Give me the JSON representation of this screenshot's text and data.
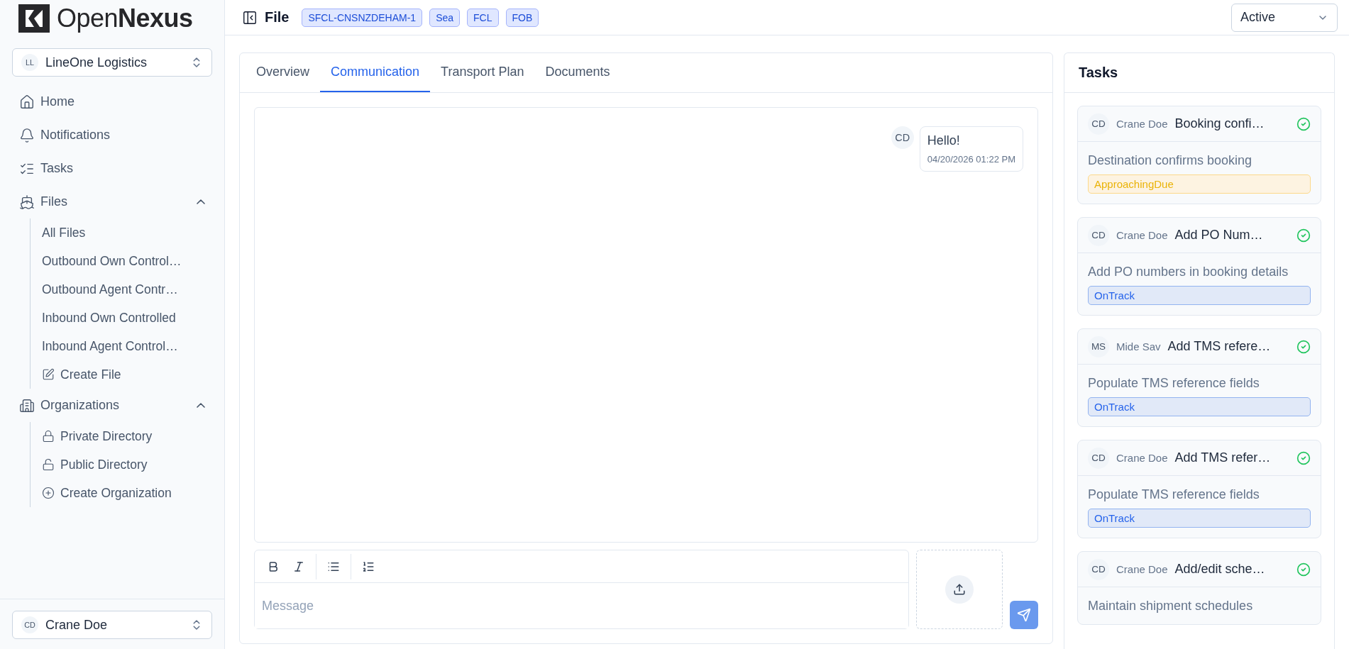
{
  "brand": {
    "light": "Open",
    "bold": "Nexus"
  },
  "organization": {
    "initials": "LL",
    "name": "LineOne Logistics"
  },
  "nav": [
    {
      "label": "Home",
      "kind": "link"
    },
    {
      "label": "Notifications",
      "kind": "link"
    },
    {
      "label": "Tasks",
      "kind": "link"
    },
    {
      "label": "Files",
      "kind": "group",
      "expanded": true,
      "children": [
        {
          "label": "All Files",
          "kind": "plain"
        },
        {
          "label": "Outbound Own Control…",
          "kind": "plain"
        },
        {
          "label": "Outbound Agent Contr…",
          "kind": "plain"
        },
        {
          "label": "Inbound Own Controlled",
          "kind": "plain"
        },
        {
          "label": "Inbound Agent Control…",
          "kind": "plain"
        },
        {
          "label": "Create File",
          "kind": "icon"
        }
      ]
    },
    {
      "label": "Organizations",
      "kind": "group",
      "expanded": true,
      "children": [
        {
          "label": "Private Directory",
          "kind": "icon"
        },
        {
          "label": "Public Directory",
          "kind": "icon"
        },
        {
          "label": "Create Organization",
          "kind": "icon"
        }
      ]
    }
  ],
  "user": {
    "initials": "CD",
    "name": "Crane Doe"
  },
  "header": {
    "title": "File",
    "badges": [
      "SFCL-CNSNZDEHAM-1",
      "Sea",
      "FCL",
      "FOB"
    ],
    "status": "Active"
  },
  "tabs": [
    {
      "label": "Overview",
      "selected": false
    },
    {
      "label": "Communication",
      "selected": true
    },
    {
      "label": "Transport Plan",
      "selected": false
    },
    {
      "label": "Documents",
      "selected": false
    }
  ],
  "messages": [
    {
      "initials": "CD",
      "text": "Hello!",
      "time": "04/20/2026 01:22 PM"
    }
  ],
  "composer": {
    "placeholder": "Message"
  },
  "tasks_panel": {
    "title": "Tasks",
    "tasks": [
      {
        "initials": "CD",
        "assignee": "Crane Doe",
        "title": "Booking confi…",
        "description": "Destination confirms booking",
        "status": {
          "label": "ApproachingDue",
          "kind": "approaching"
        },
        "done": true
      },
      {
        "initials": "CD",
        "assignee": "Crane Doe",
        "title": "Add PO Num…",
        "description": "Add PO numbers in booking details",
        "status": {
          "label": "OnTrack",
          "kind": "ontrack"
        },
        "done": true
      },
      {
        "initials": "MS",
        "assignee": "Mide Sav",
        "title": "Add TMS refere…",
        "description": "Populate TMS reference fields",
        "status": {
          "label": "OnTrack",
          "kind": "ontrack"
        },
        "done": true
      },
      {
        "initials": "CD",
        "assignee": "Crane Doe",
        "title": "Add TMS refer…",
        "description": "Populate TMS reference fields",
        "status": {
          "label": "OnTrack",
          "kind": "ontrack"
        },
        "done": true
      },
      {
        "initials": "CD",
        "assignee": "Crane Doe",
        "title": "Add/edit sche…",
        "description": "Maintain shipment schedules",
        "done": true
      }
    ]
  }
}
